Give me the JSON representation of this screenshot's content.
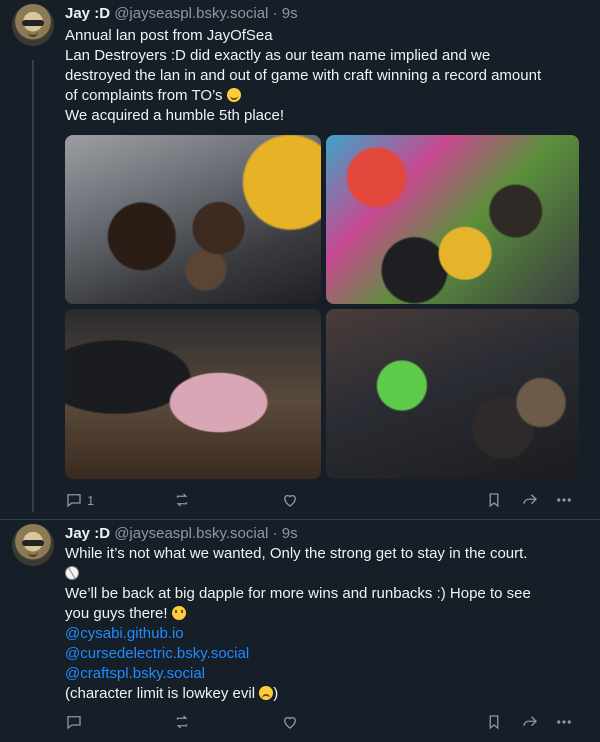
{
  "posts": [
    {
      "author": {
        "name": "Jay :D",
        "handle": "@jayseaspl.bsky.social",
        "separator": "·",
        "time": "9s"
      },
      "text": {
        "l1": "Annual lan post from JayOfSea",
        "l2": "Lan Destroyers :D did exactly as our team name implied and we",
        "l3": "destroyed the lan in and out of game with craft winning a record amount",
        "l4": "of complaints from TO’s",
        "l5": "We acquired a humble 5th place!"
      },
      "images": [
        "lan-group-photo-1",
        "lan-group-photo-2",
        "lan-setup-photo",
        "lan-monitors-photo"
      ],
      "actions": {
        "reply_count": "1"
      }
    },
    {
      "author": {
        "name": "Jay :D",
        "handle": "@jayseaspl.bsky.social",
        "separator": "·",
        "time": "9s"
      },
      "text": {
        "l1": "While it’s not what we wanted, Only the strong get to stay in the court.",
        "l2": "We’ll be back at big dapple for more wins and runbacks :) Hope to see",
        "l3": "you guys there!",
        "mention1": "@cysabi.github.io",
        "mention2": "@cursedelectric.bsky.social",
        "mention3": "@craftspl.bsky.social",
        "l4": "(character limit is lowkey evil"
      },
      "actions": {
        "reply_count": ""
      }
    }
  ],
  "colors": {
    "background": "#161e27",
    "link": "#208bfe",
    "muted": "#8b98a5",
    "divider": "#2e4052"
  },
  "icons": [
    "reply-icon",
    "repost-icon",
    "like-icon",
    "bookmark-icon",
    "share-icon",
    "more-icon"
  ]
}
